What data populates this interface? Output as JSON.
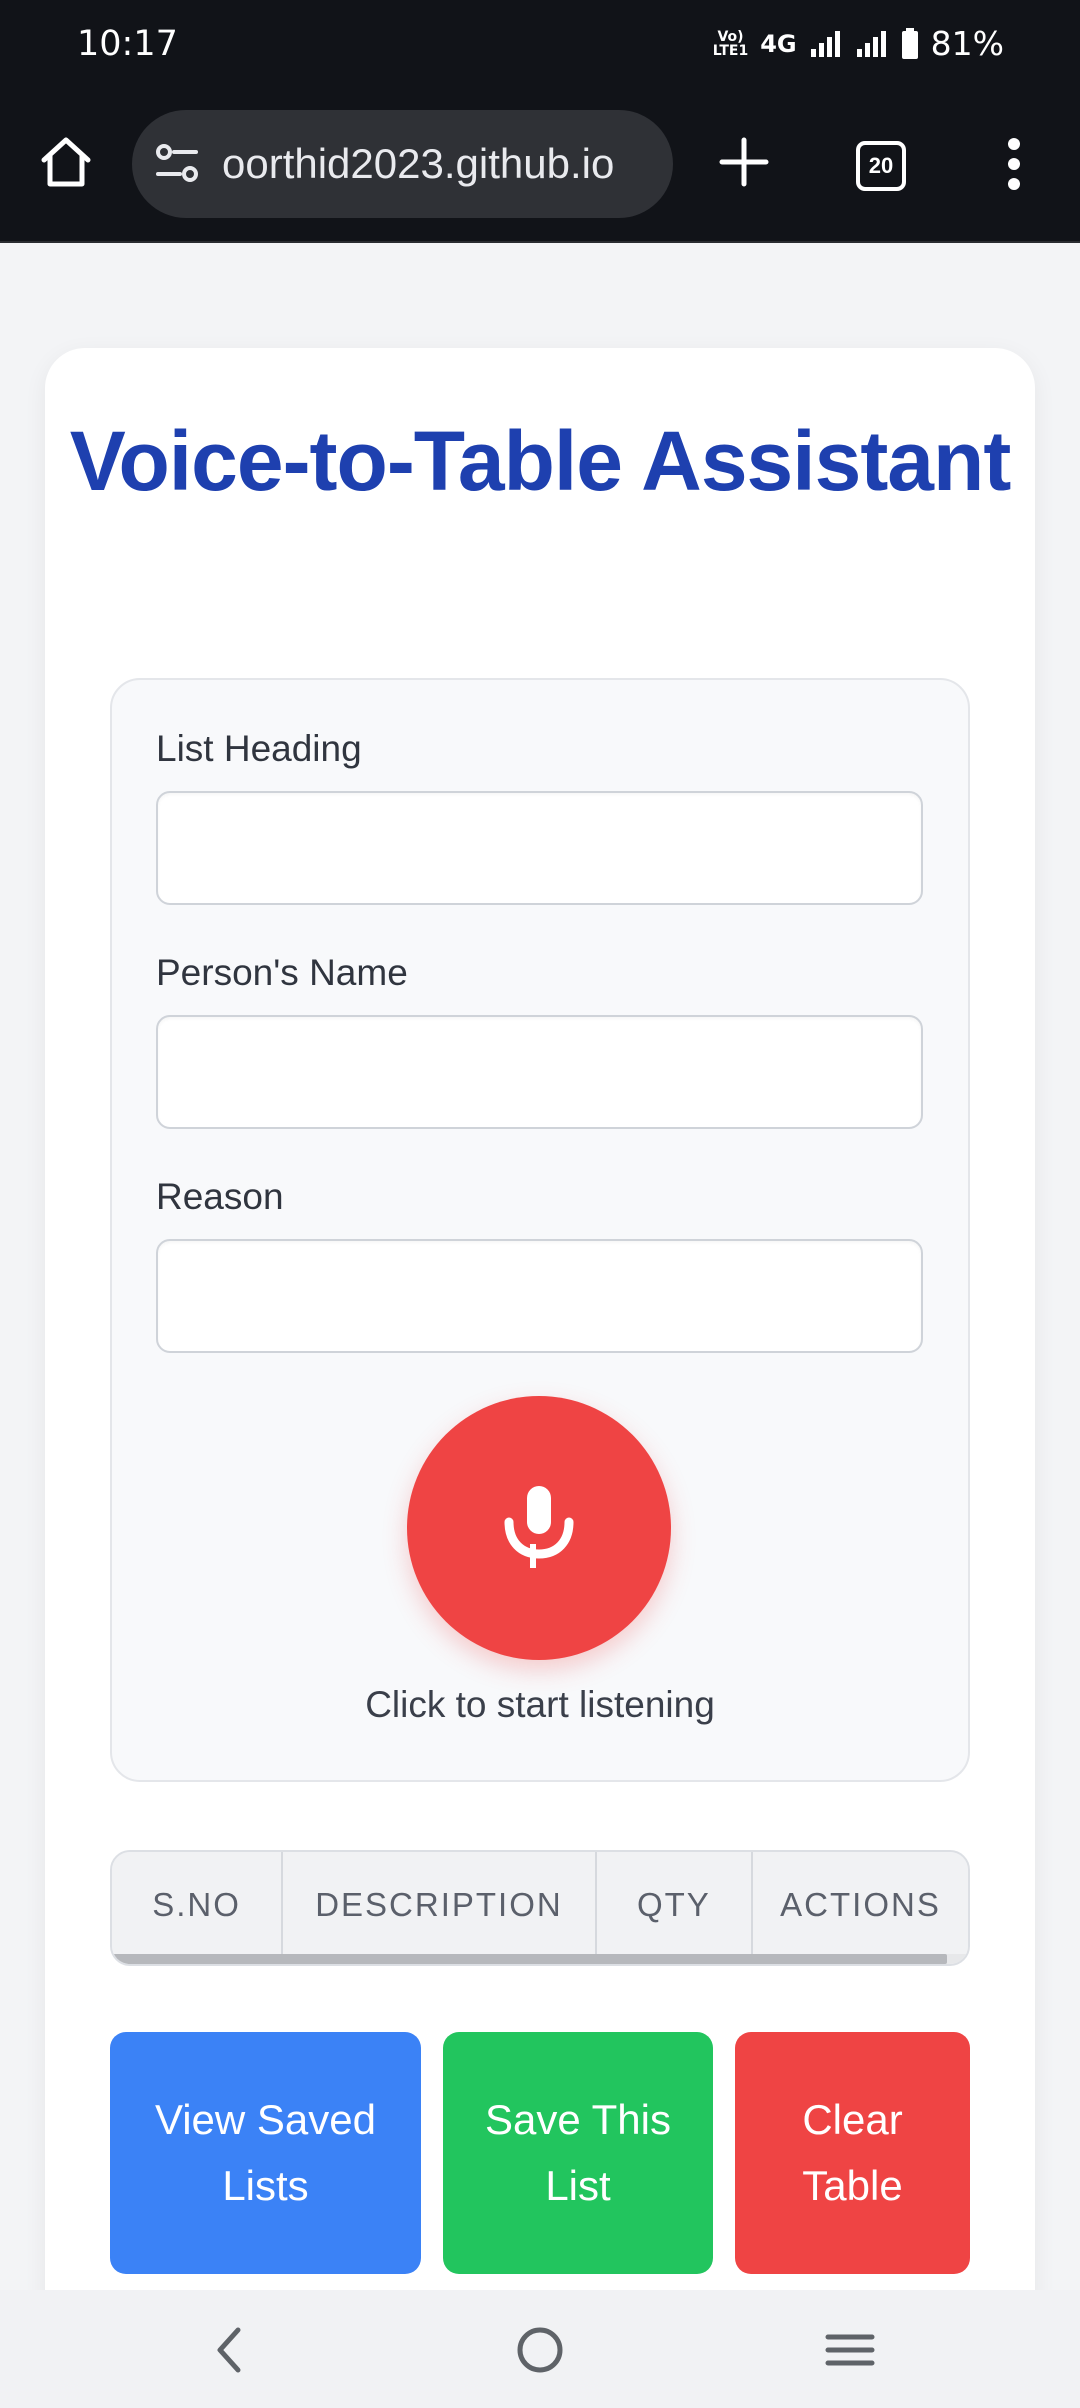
{
  "status_bar": {
    "time": "10:17",
    "volte": "Vo)\nLTE1",
    "network": "4G",
    "battery": "81%"
  },
  "browser": {
    "url": "oorthid2023.github.io",
    "tab_count": "20"
  },
  "page": {
    "title": "Voice-to-Table Assistant",
    "fields": {
      "list_heading": {
        "label": "List Heading",
        "value": ""
      },
      "person_name": {
        "label": "Person's Name",
        "value": ""
      },
      "reason": {
        "label": "Reason",
        "value": ""
      }
    },
    "mic_status": "Click to start listening",
    "table": {
      "columns": [
        "S.NO",
        "DESCRIPTION",
        "QTY",
        "ACTIONS"
      ]
    },
    "buttons": {
      "view_saved": "View Saved Lists",
      "save_list": "Save This List",
      "clear_table": "Clear Table"
    }
  },
  "colors": {
    "title": "#1e40af",
    "mic": "#ef4444",
    "view_button": "#3b82f6",
    "save_button": "#22c55e",
    "clear_button": "#ef4444"
  },
  "icons": [
    "home-icon",
    "site-settings-icon",
    "plus-icon",
    "tab-switcher-icon",
    "more-vert-icon",
    "microphone-icon",
    "back-icon",
    "home-circle-icon",
    "recent-apps-icon"
  ]
}
